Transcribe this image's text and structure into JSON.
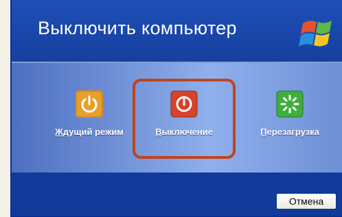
{
  "window": {
    "title": "Выключить компьютер"
  },
  "options": [
    {
      "accel": "Ж",
      "rest": "дущий режим",
      "icon": "standby-icon",
      "color": "#e8a02a"
    },
    {
      "accel": "В",
      "rest": "ыключение",
      "icon": "power-off-icon",
      "color": "#d5442b",
      "selected": true
    },
    {
      "accel": "П",
      "rest": "ерезагрузка",
      "icon": "restart-icon",
      "color": "#3fae3a"
    }
  ],
  "footer": {
    "cancel_label": "Отмена"
  },
  "colors": {
    "header": "#1e4fb6",
    "highlight": "#c2431d"
  }
}
